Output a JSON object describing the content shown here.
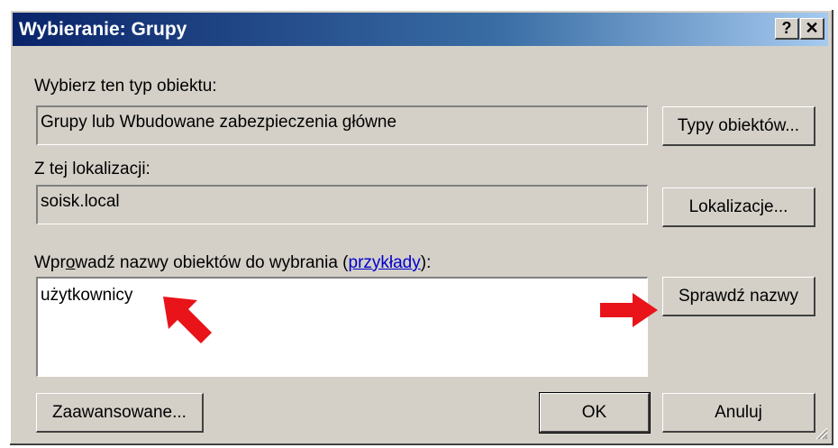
{
  "window": {
    "title": "Wybieranie: Grupy",
    "help_glyph": "?",
    "close_glyph": "✕"
  },
  "object_type": {
    "label": "Wybierz ten typ obiektu:",
    "value": "Grupy lub Wbudowane zabezpieczenia główne",
    "button": "Typy obiektów..."
  },
  "location": {
    "label": "Z tej lokalizacji:",
    "value": "soisk.local",
    "button": "Lokalizacje..."
  },
  "names": {
    "label_pre": "Wpr",
    "label_accel": "o",
    "label_mid": "wadź nazwy obiektów do wybrania (",
    "label_link": "przykłady",
    "label_post": "):",
    "value": "użytkownicy",
    "check_button": "Sprawdź nazwy"
  },
  "footer": {
    "advanced_button": "Zaawansowane...",
    "ok_button": "OK",
    "cancel_button": "Anuluj"
  },
  "annotations": {
    "arrow_color": "#e8141a",
    "arrows": [
      "arrow-pointing-to-input",
      "arrow-pointing-to-check-names"
    ]
  }
}
